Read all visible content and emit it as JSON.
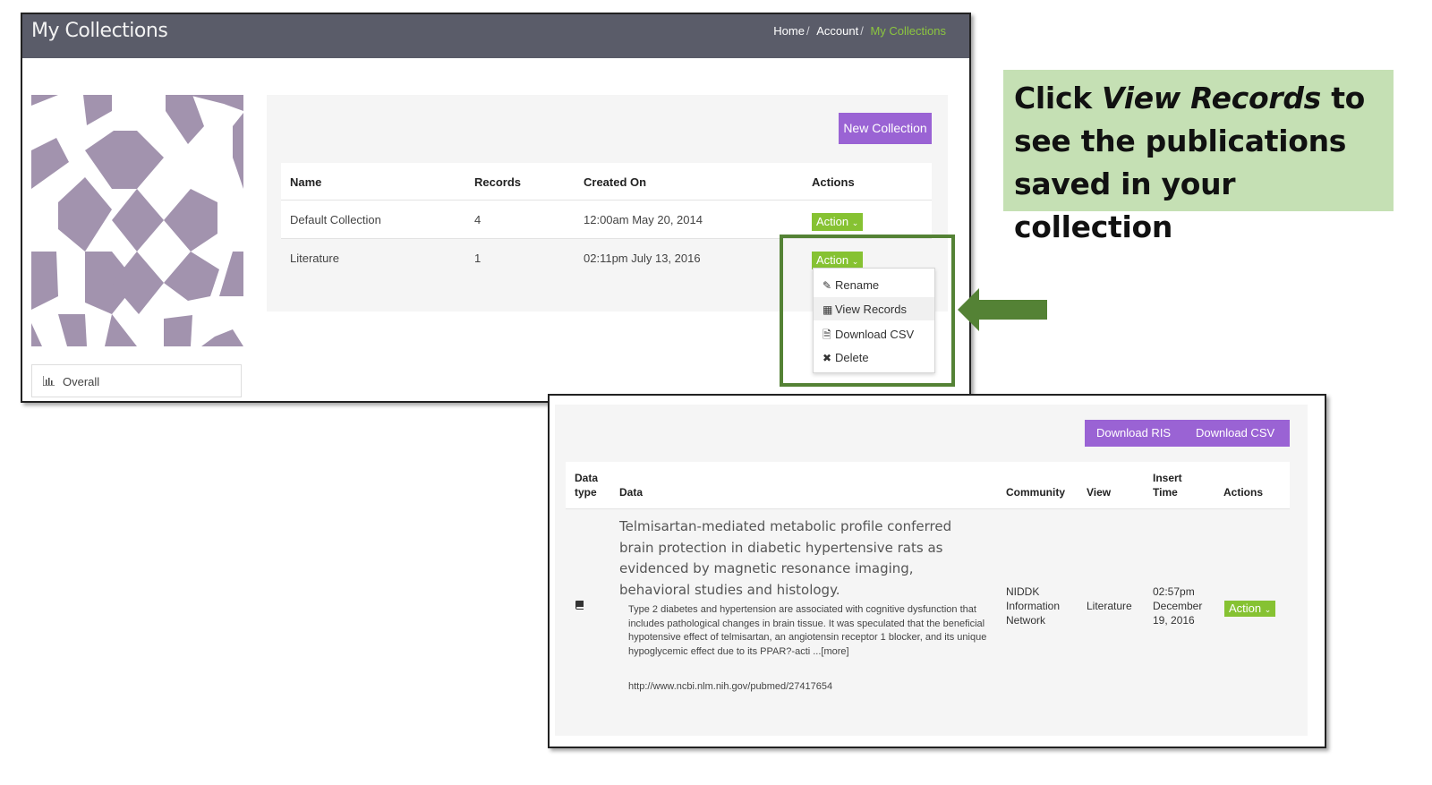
{
  "header": {
    "title": "My Collections",
    "breadcrumbs": [
      "Home",
      "Account",
      "My Collections"
    ],
    "breadcrumb_sep": "/"
  },
  "sidebar": {
    "overall_label": "Overall"
  },
  "collections": {
    "new_button": "New Collection",
    "columns": [
      "Name",
      "Records",
      "Created On",
      "Actions"
    ],
    "rows": [
      {
        "name": "Default Collection",
        "records": "4",
        "created": "12:00am May 20, 2014",
        "action": "Action"
      },
      {
        "name": "Literature",
        "records": "1",
        "created": "02:11pm July 13, 2016",
        "action": "Action"
      }
    ],
    "menu": [
      {
        "icon": "pencil-icon",
        "label": "Rename"
      },
      {
        "icon": "table-icon",
        "label": "View Records"
      },
      {
        "icon": "file-icon",
        "label": "Download CSV"
      },
      {
        "icon": "x-icon",
        "label": "Delete"
      }
    ]
  },
  "callout": {
    "pre": "Click ",
    "emph": "View Records",
    "post": " to see the publications saved in your collection"
  },
  "records": {
    "download_ris": "Download RIS",
    "download_csv": "Download CSV",
    "columns": {
      "datatype_1": "Data",
      "datatype_2": "type",
      "data": "Data",
      "community": "Community",
      "view": "View",
      "insert_1": "Insert",
      "insert_2": "Time",
      "actions": "Actions"
    },
    "row": {
      "icon": "book-icon",
      "title": "Telmisartan-mediated metabolic profile conferred brain protection in diabetic hypertensive rats as evidenced by magnetic resonance imaging, behavioral studies and histology.",
      "abstract": "Type 2 diabetes and hypertension are associated with cognitive dysfunction that includes pathological changes in brain tissue. It was speculated that the beneficial hypotensive effect of telmisartan, an angiotensin receptor 1 blocker, and its unique hypoglycemic effect due to its PPAR?-acti ...[more]",
      "url": "http://www.ncbi.nlm.nih.gov/pubmed/27417654",
      "community_1": "NIDDK",
      "community_2": "Information",
      "community_3": "Network",
      "view": "Literature",
      "time_1": "02:57pm",
      "time_2": "December",
      "time_3": "19, 2016",
      "action": "Action"
    }
  },
  "colors": {
    "topbar": "#5a5c69",
    "accent_green": "#86c232",
    "purple": "#9a63d4",
    "highlight_box": "#548235",
    "callout_bg": "#c5e0b4"
  }
}
